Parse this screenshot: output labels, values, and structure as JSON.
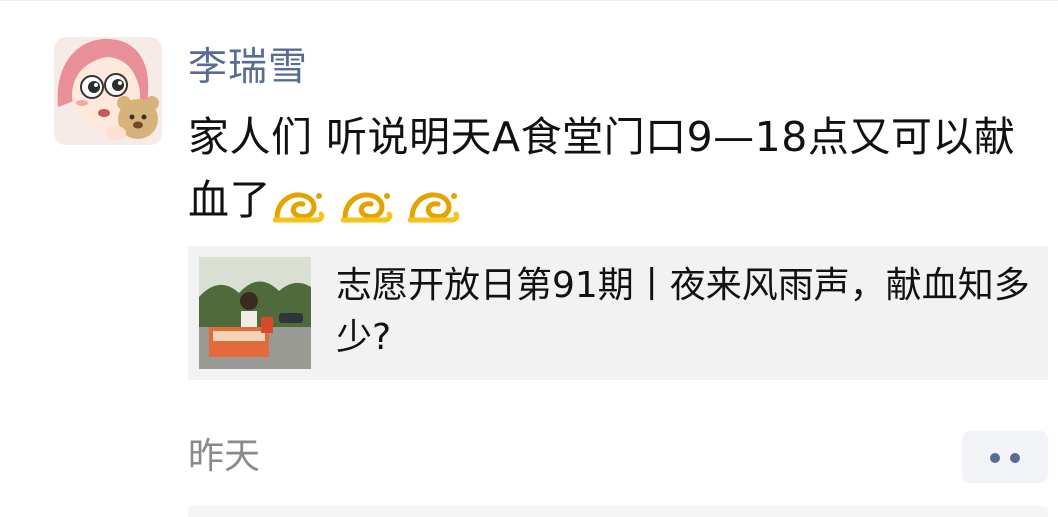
{
  "post": {
    "username": "李瑞雪",
    "text": "家人们 听说明天A食堂门口9—18点又可以献血了",
    "emoji": [
      "snail-emoji",
      "snail-emoji",
      "snail-emoji"
    ],
    "link": {
      "title": "志愿开放日第91期丨夜来风雨声，献血知多少?"
    },
    "timestamp": "昨天"
  },
  "colors": {
    "username": "#576b95",
    "text": "#111111",
    "card_bg": "#f2f2f2",
    "timestamp": "#8a8a8a",
    "more_dots": "#576b95"
  },
  "icons": {
    "more": "more-dots-icon",
    "emoji": "snail-emoji-icon"
  }
}
